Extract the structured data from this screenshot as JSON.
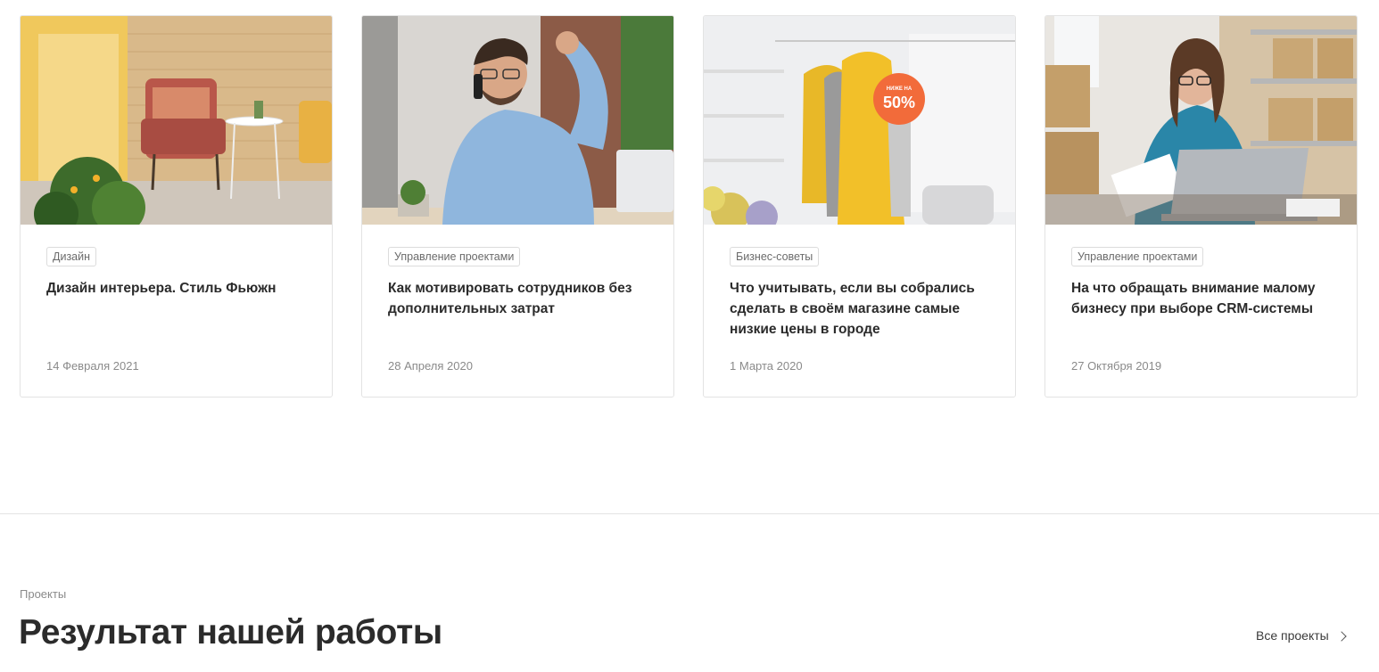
{
  "cards": [
    {
      "tag": "Дизайн",
      "title": "Дизайн интерьера. Стиль Фьюжн",
      "date": "14 Февраля 2021"
    },
    {
      "tag": "Управление проектами",
      "title": "Как мотивировать сотрудников без дополнительных затрат",
      "date": "28 Апреля 2020"
    },
    {
      "tag": "Бизнес-советы",
      "title": "Что учитывать, если вы собрались сделать в своём магазине самые низкие цены в городе",
      "date": "1 Марта 2020",
      "badge_top": "НИЖЕ НА",
      "badge_value": "50%"
    },
    {
      "tag": "Управление проектами",
      "title": "На что обращать внимание малому бизнесу при выборе CRM-системы",
      "date": "27 Октября 2019"
    }
  ],
  "projects": {
    "label": "Проекты",
    "title": "Результат нашей работы",
    "all_link": "Все проекты"
  },
  "colors": {
    "badge": "#f26b3a",
    "coat_yellow": "#f2c029",
    "shirt_blue": "#8fb6dd",
    "sweater_teal": "#2a86a8"
  }
}
